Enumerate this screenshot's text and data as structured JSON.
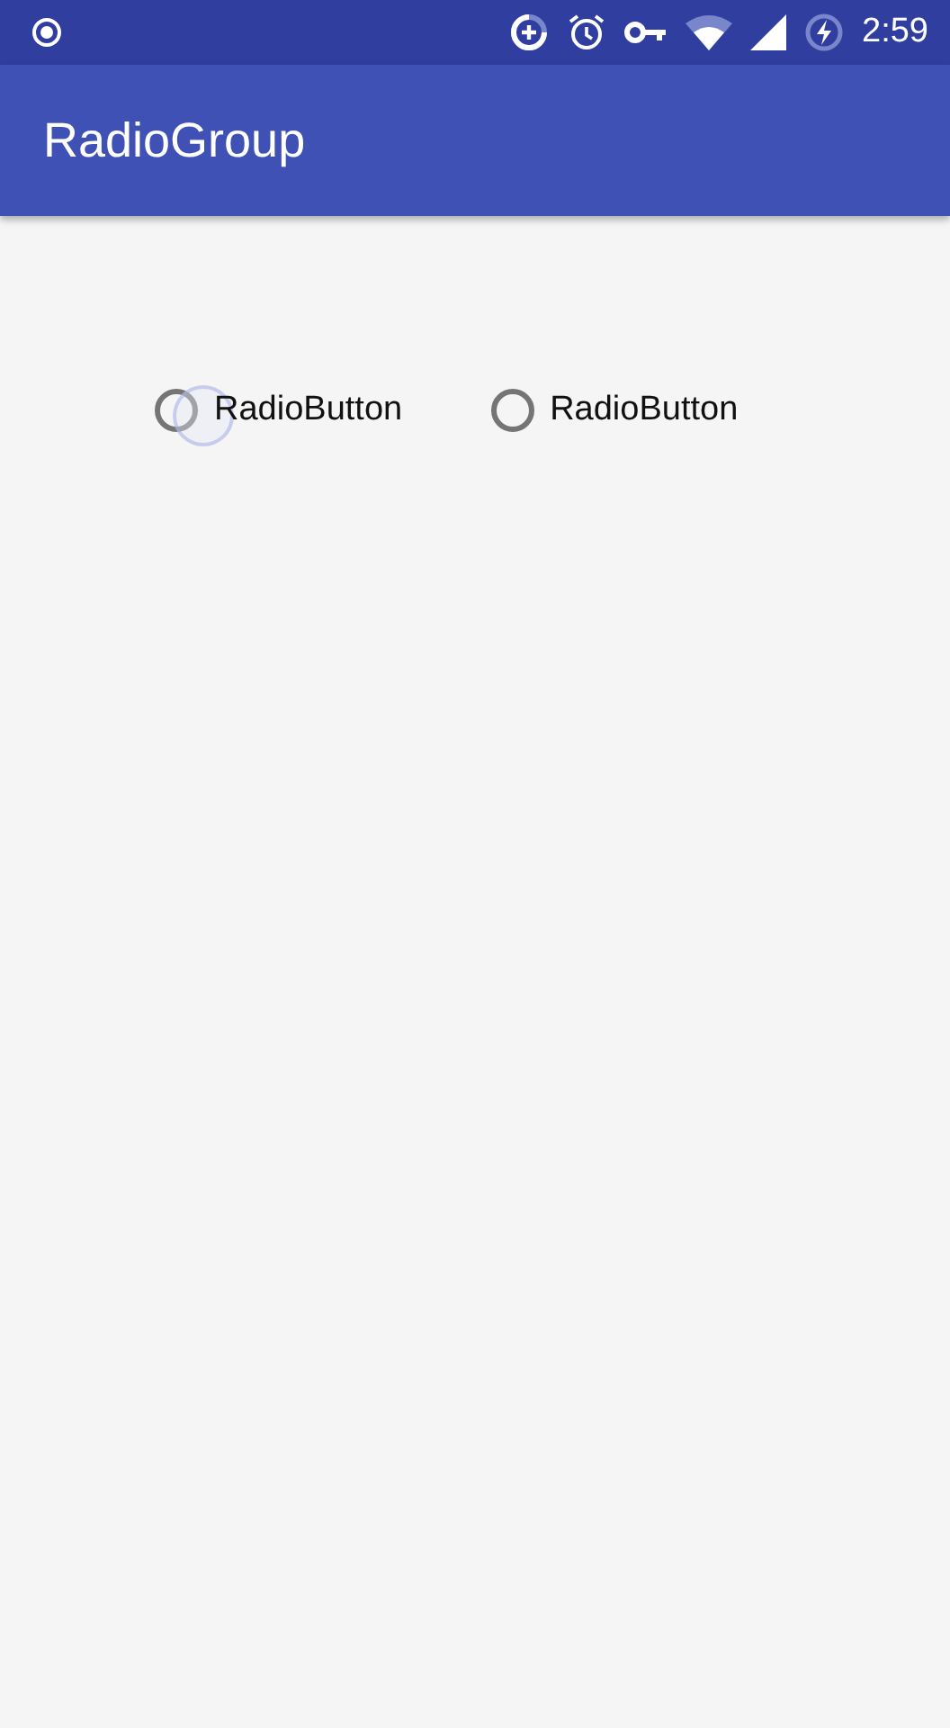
{
  "status_bar": {
    "time": "2:59"
  },
  "app_bar": {
    "title": "RadioGroup"
  },
  "radio_group": [
    {
      "label": "RadioButton",
      "selected": false,
      "pressed": true
    },
    {
      "label": "RadioButton",
      "selected": false,
      "pressed": false
    }
  ]
}
